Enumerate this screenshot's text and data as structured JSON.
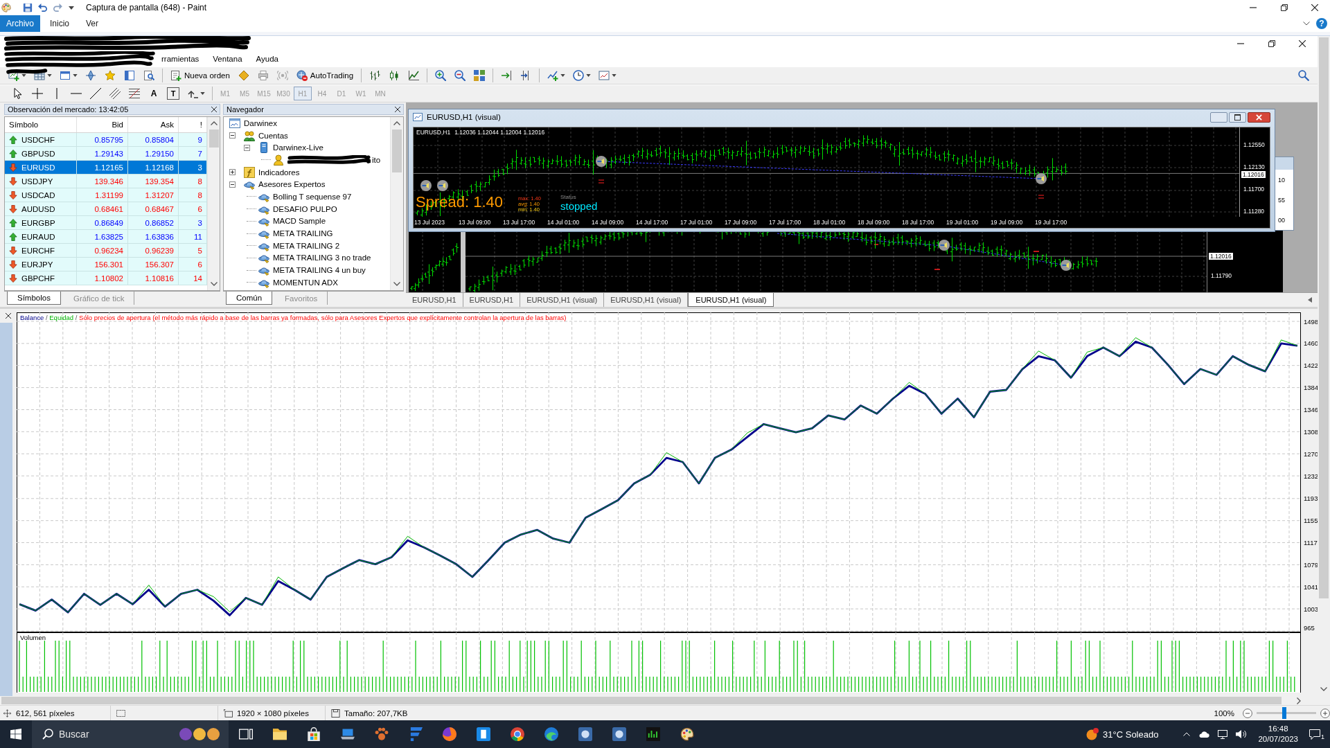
{
  "paint": {
    "title": "Captura de pantalla (648) - Paint",
    "ribbon_tabs": [
      {
        "label": "Archivo",
        "selected": true
      },
      {
        "label": "Inicio",
        "selected": false
      },
      {
        "label": "Ver",
        "selected": false
      }
    ],
    "help": "?",
    "status_bar": {
      "cursor": "612, 561 píxeles",
      "dimensions": "1920 × 1080 píxeles",
      "file_size": "Tamaño: 207,7KB",
      "zoom": "100%",
      "zoom_slider": {
        "level": 0.47
      }
    }
  },
  "terminal": {
    "menu": [
      "rramientas",
      "Ventana",
      "Ayuda"
    ],
    "toolbar": {
      "new_order": "Nueva orden",
      "autotrading": "AutoTrading",
      "text_tool": "A",
      "label_tool": "T"
    },
    "timeframes": [
      {
        "label": "M1",
        "selected": false,
        "disabled": true
      },
      {
        "label": "M5",
        "selected": false,
        "disabled": true
      },
      {
        "label": "M15",
        "selected": false,
        "disabled": true
      },
      {
        "label": "M30",
        "selected": false,
        "disabled": true
      },
      {
        "label": "H1",
        "selected": true,
        "disabled": true
      },
      {
        "label": "H4",
        "selected": false,
        "disabled": true
      },
      {
        "label": "D1",
        "selected": false,
        "disabled": true
      },
      {
        "label": "W1",
        "selected": false,
        "disabled": true
      },
      {
        "label": "MN",
        "selected": false,
        "disabled": true
      }
    ],
    "market_watch": {
      "title": "Observación del mercado: 13:42:05",
      "columns": [
        "Símbolo",
        "Bid",
        "Ask",
        "!"
      ],
      "rows": [
        {
          "symbol": "USDCHF",
          "bid": "0.85795",
          "ask": "0.85804",
          "spread": "9",
          "rising": true,
          "selected": false
        },
        {
          "symbol": "GBPUSD",
          "bid": "1.29143",
          "ask": "1.29150",
          "spread": "7",
          "rising": true,
          "selected": false
        },
        {
          "symbol": "EURUSD",
          "bid": "1.12165",
          "ask": "1.12168",
          "spread": "3",
          "rising": false,
          "selected": true
        },
        {
          "symbol": "USDJPY",
          "bid": "139.346",
          "ask": "139.354",
          "spread": "8",
          "rising": false,
          "selected": false
        },
        {
          "symbol": "USDCAD",
          "bid": "1.31199",
          "ask": "1.31207",
          "spread": "8",
          "rising": false,
          "selected": false
        },
        {
          "symbol": "AUDUSD",
          "bid": "0.68461",
          "ask": "0.68467",
          "spread": "6",
          "rising": false,
          "selected": false
        },
        {
          "symbol": "EURGBP",
          "bid": "0.86849",
          "ask": "0.86852",
          "spread": "3",
          "rising": true,
          "selected": false
        },
        {
          "symbol": "EURAUD",
          "bid": "1.63825",
          "ask": "1.63836",
          "spread": "11",
          "rising": true,
          "selected": false
        },
        {
          "symbol": "EURCHF",
          "bid": "0.96234",
          "ask": "0.96239",
          "spread": "5",
          "rising": false,
          "selected": false
        },
        {
          "symbol": "EURJPY",
          "bid": "156.301",
          "ask": "156.307",
          "spread": "6",
          "rising": false,
          "selected": false
        },
        {
          "symbol": "GBPCHF",
          "bid": "1.10802",
          "ask": "1.10816",
          "spread": "14",
          "rising": false,
          "selected": false
        }
      ],
      "tabs": [
        {
          "label": "Símbolos",
          "selected": true
        },
        {
          "label": "Gráfico de tick",
          "selected": false
        }
      ]
    },
    "navigator": {
      "title": "Navegador",
      "tree": [
        {
          "label": "Darwinex",
          "kind": "terminal",
          "children": [
            {
              "label": "Cuentas",
              "kind": "accounts",
              "expanded": true,
              "children": [
                {
                  "label": "Darwinex-Live",
                  "kind": "server",
                  "expanded": true,
                  "children": [
                    {
                      "label": "ito",
                      "kind": "account"
                    }
                  ]
                }
              ]
            },
            {
              "label": "Indicadores",
              "kind": "indicators",
              "expanded": false
            },
            {
              "label": "Asesores Expertos",
              "kind": "experts",
              "expanded": true,
              "children": [
                {
                  "label": "Bolling T sequense 97",
                  "kind": "expert"
                },
                {
                  "label": "DESAFIO PULPO",
                  "kind": "expert"
                },
                {
                  "label": "MACD Sample",
                  "kind": "expert"
                },
                {
                  "label": "META TRAILING",
                  "kind": "expert"
                },
                {
                  "label": "META TRAILING 2",
                  "kind": "expert"
                },
                {
                  "label": "META TRAILING 3 no trade",
                  "kind": "expert"
                },
                {
                  "label": "META TRAILING 4 un buy",
                  "kind": "expert"
                },
                {
                  "label": "MOMENTUN ADX",
                  "kind": "expert"
                }
              ]
            }
          ]
        }
      ],
      "tabs": [
        {
          "label": "Común",
          "selected": true
        },
        {
          "label": "Favoritos",
          "selected": false
        }
      ]
    },
    "chart_window": {
      "title": "EURUSD,H1 (visual)",
      "symbol": "EURUSD,H1",
      "ohlc": "1.12036 1.12044 1.12004 1.12016",
      "price_labels": [
        "1.12550",
        "1.12130",
        "1.11700",
        "1.11280"
      ],
      "current_price": "1.12016",
      "time_labels": [
        "13 Jul 2023",
        "13 Jul 09:00",
        "13 Jul 17:00",
        "14 Jul 01:00",
        "14 Jul 09:00",
        "14 Jul 17:00",
        "17 Jul 01:00",
        "17 Jul 09:00",
        "17 Jul 17:00",
        "18 Jul 01:00",
        "18 Jul 09:00",
        "18 Jul 17:00",
        "19 Jul 01:00",
        "19 Jul 09:00",
        "19 Jul 17:00"
      ],
      "spread": {
        "label": "Spread: 1.40",
        "max": "max: 1.40",
        "avg": "avg: 1.40",
        "min": "min: 1.40",
        "status_label": "Status",
        "status": "stopped"
      }
    },
    "back_chart": {
      "current_price": "1.12016",
      "price_labels": [
        "1.11790"
      ]
    },
    "side_window": {
      "price_labels": [
        "10",
        "55",
        "00"
      ]
    },
    "chart_tabs": [
      {
        "label": "EURUSD,H1",
        "selected": false
      },
      {
        "label": "EURUSD,H1",
        "selected": false
      },
      {
        "label": "EURUSD,H1 (visual)",
        "selected": false
      },
      {
        "label": "EURUSD,H1 (visual)",
        "selected": false
      },
      {
        "label": "EURUSD,H1 (visual)",
        "selected": true
      }
    ],
    "tester": {
      "legend_separator": "/",
      "volume_label": "Volumen",
      "chart_data": {
        "type": "line",
        "title": "Sólo precios de apertura (el método más rápido a base de las barras ya formadas, sólo para Asesores Expertos que explícitamente controlan la apertura de las barras)",
        "grid": true,
        "ylim": [
          965,
          1498
        ],
        "yticks": [
          965,
          1003,
          1041,
          1079,
          1117,
          1155,
          1193,
          1232,
          1270,
          1308,
          1346,
          1384,
          1422,
          1460,
          1498
        ],
        "series": [
          {
            "name": "Balance",
            "color": "#00008b",
            "values": [
              1011,
              1000,
              1019,
              997,
              1029,
              1010,
              1029,
              1011,
              1036,
              1007,
              1029,
              1036,
              1017,
              992,
              1022,
              1010,
              1051,
              1036,
              1019,
              1058,
              1073,
              1087,
              1080,
              1092,
              1121,
              1109,
              1095,
              1080,
              1058,
              1087,
              1117,
              1131,
              1139,
              1124,
              1117,
              1160,
              1175,
              1190,
              1219,
              1234,
              1263,
              1256,
              1219,
              1263,
              1277,
              1299,
              1321,
              1314,
              1307,
              1314,
              1336,
              1329,
              1353,
              1339,
              1365,
              1387,
              1373,
              1339,
              1365,
              1333,
              1377,
              1380,
              1416,
              1438,
              1431,
              1401,
              1438,
              1453,
              1438,
              1463,
              1453,
              1423,
              1390,
              1416,
              1406,
              1438,
              1423,
              1412,
              1460,
              1456
            ]
          },
          {
            "name": "Equidad",
            "color": "#00b400",
            "values": [
              1011,
              1000,
              1019,
              997,
              1029,
              1010,
              1029,
              1011,
              1044,
              1007,
              1029,
              1036,
              1024,
              998,
              1022,
              1010,
              1058,
              1036,
              1019,
              1058,
              1073,
              1087,
              1080,
              1092,
              1128,
              1109,
              1095,
              1080,
              1058,
              1087,
              1117,
              1131,
              1139,
              1124,
              1117,
              1160,
              1175,
              1190,
              1219,
              1234,
              1272,
              1256,
              1219,
              1263,
              1277,
              1306,
              1321,
              1314,
              1307,
              1314,
              1336,
              1329,
              1353,
              1339,
              1365,
              1393,
              1373,
              1339,
              1365,
              1333,
              1377,
              1380,
              1416,
              1447,
              1431,
              1401,
              1445,
              1453,
              1438,
              1470,
              1453,
              1423,
              1390,
              1416,
              1406,
              1438,
              1423,
              1412,
              1466,
              1456
            ]
          }
        ]
      }
    }
  },
  "taskbar": {
    "search_placeholder": "Buscar",
    "weather": "31°C Soleado",
    "time": "16:48",
    "date": "20/07/2023",
    "notification_count": "1"
  }
}
